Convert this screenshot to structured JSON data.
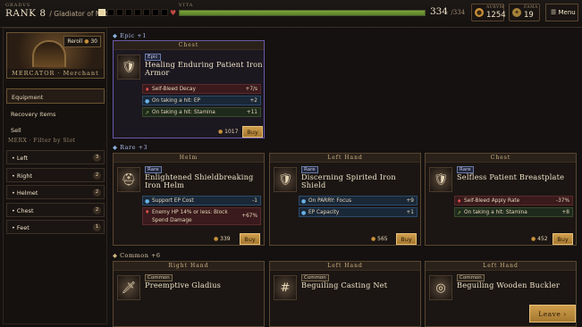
{
  "header": {
    "grade_label": "GRADVS",
    "rank": "RANK 8",
    "rank_title": "/ Gladiator of Note",
    "grade_bars": [
      true,
      false,
      false,
      false,
      false,
      false,
      false,
      false
    ],
    "vita_label": "VITA",
    "vita_current": "334",
    "vita_max": "/334",
    "vita_fill": 1.0,
    "aurum_label": "AVRVM",
    "aurum_value": "1254",
    "fama_label": "FAMA",
    "fama_value": "19",
    "menu_label": "Menu"
  },
  "sidebar": {
    "reroll_label": "Reroll",
    "reroll_cost": "30",
    "merchant_caption": "MERCATOR · Merchant",
    "nav": [
      "Equipment",
      "Recovery Items",
      "Sell"
    ],
    "filter_heading": "MERX · Filter by Slot",
    "slots": [
      {
        "label": "Left",
        "count": "3"
      },
      {
        "label": "Right",
        "count": "2"
      },
      {
        "label": "Helmet",
        "count": "2"
      },
      {
        "label": "Chest",
        "count": "2"
      },
      {
        "label": "Feet",
        "count": "1"
      }
    ]
  },
  "sections": {
    "epic": "Epic +1",
    "rare": "Rare +3",
    "common": "Common +6"
  },
  "cards": {
    "epic_chest": {
      "slot": "Chest",
      "rarity": "Epic",
      "name": "Healing Enduring Patient Iron Armor",
      "stats": [
        {
          "label": "Self-Bleed Decay",
          "value": "+7/s"
        },
        {
          "label": "On taking a hit: EP",
          "value": "+2"
        },
        {
          "label": "On taking a hit: Stamina",
          "value": "+11"
        }
      ],
      "price": "1017",
      "buy": "Buy"
    },
    "rare_helm": {
      "slot": "Helm",
      "rarity": "Rare",
      "name": "Enlightened Shieldbreaking Iron Helm",
      "stats": [
        {
          "label": "Support EP Cost",
          "value": "-1"
        },
        {
          "label": "Enemy HP 14% or less: Block Spend Damage",
          "value": "+67%"
        }
      ],
      "price": "339",
      "buy": "Buy"
    },
    "rare_left": {
      "slot": "Left Hand",
      "rarity": "Rare",
      "name": "Discerning Spirited Iron Shield",
      "stats": [
        {
          "label": "On PARRY: Focus",
          "value": "+9"
        },
        {
          "label": "EP Capacity",
          "value": "+1"
        }
      ],
      "price": "565",
      "buy": "Buy"
    },
    "rare_chest": {
      "slot": "Chest",
      "rarity": "Rare",
      "name": "Selfless Patient Breastplate",
      "stats": [
        {
          "label": "Self-Bleed Apply Rate",
          "value": "-37%"
        },
        {
          "label": "On taking a hit: Stamina",
          "value": "+8"
        }
      ],
      "price": "452",
      "buy": "Buy"
    },
    "common_right": {
      "slot": "Right Hand",
      "rarity": "Common",
      "name": "Preemptive Gladius"
    },
    "common_left1": {
      "slot": "Left Hand",
      "rarity": "Common",
      "name": "Beguiling Casting Net"
    },
    "common_left2": {
      "slot": "Left Hand",
      "rarity": "Common",
      "name": "Beguiling Wooden Buckler"
    }
  },
  "footer": {
    "leave": "Leave ›"
  },
  "colors": {
    "accent": "#d7b36b",
    "vita": "#6f9a34",
    "epic": "#6a5aa8"
  }
}
